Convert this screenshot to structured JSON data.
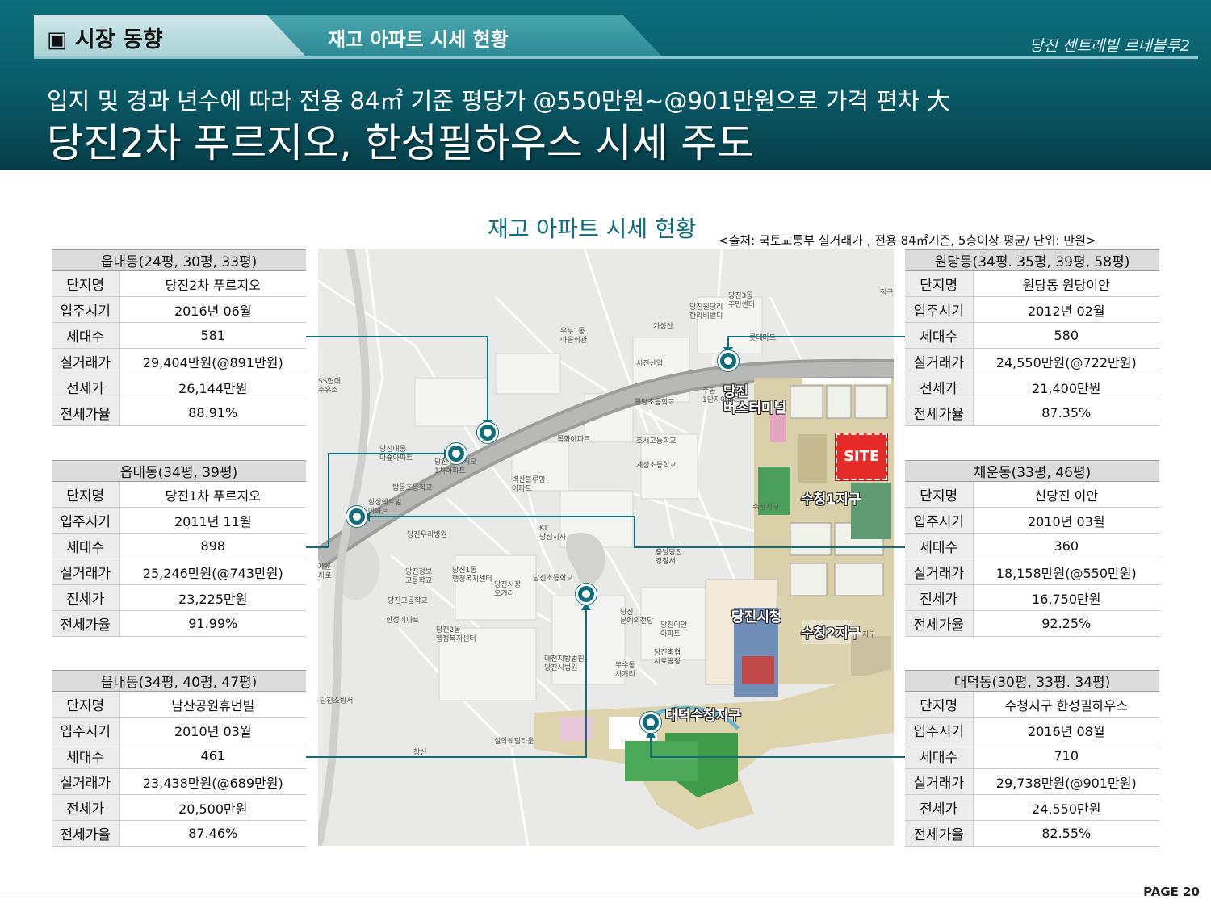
{
  "header": {
    "section_label": "▣ 시장 동향",
    "tab_label": "재고 아파트 시세 현황",
    "brand": "당진 센트레빌 르네블루2",
    "subtitle": "입지 및 경과 년수에 따라 전용 84㎡ 기준 평당가 @550만원~@901만원으로 가격 편차 大",
    "title": "당진2차 푸르지오, 한성필하우스 시세 주도"
  },
  "map_title": "재고 아파트 시세 현황",
  "source_note": "<출처: 국토교통부 실거래가 , 전용 84㎡기준, 5층이상 평균/ 단위: 만원>",
  "row_keys": [
    "단지명",
    "입주시기",
    "세대수",
    "실거래가",
    "전세가",
    "전세가율"
  ],
  "tables": [
    {
      "header": "읍내동(24평, 30평, 33평)",
      "values": [
        "당진2차 푸르지오",
        "2016년 06월",
        "581",
        "29,404만원(@891만원)",
        "26,144만원",
        "88.91%"
      ]
    },
    {
      "header": "읍내동(34평, 39평)",
      "values": [
        "당진1차 푸르지오",
        "2011년 11월",
        "898",
        "25,246만원(@743만원)",
        "23,225만원",
        "91.99%"
      ]
    },
    {
      "header": "읍내동(34평, 40평, 47평)",
      "values": [
        "남산공원휴먼빌",
        "2010년 03월",
        "461",
        "23,438만원(@689만원)",
        "20,500만원",
        "87.46%"
      ]
    },
    {
      "header": "원당동(34평. 35평, 39평, 58평)",
      "values": [
        "원당동 원당이안",
        "2012년 02월",
        "580",
        "24,550만원(@722만원)",
        "21,400만원",
        "87.35%"
      ]
    },
    {
      "header": "채운동(33평, 46평)",
      "values": [
        "신당진 이안",
        "2010년 03월",
        "360",
        "18,158만원(@550만원)",
        "16,750만원",
        "92.25%"
      ]
    },
    {
      "header": "대덕동(30평, 33평. 34평)",
      "values": [
        "수청지구 한성필하우스",
        "2016년 08월",
        "710",
        "29,738만원(@901만원)",
        "24,550만원",
        "82.55%"
      ]
    }
  ],
  "map": {
    "site_label": "SITE",
    "zones": {
      "terminal": "당진\n버스터미널",
      "sucheong1": "수청1지구",
      "sucheong2": "수청2지구",
      "cityhall": "당진시청",
      "daedeok": "대덕수청지구"
    },
    "labels": {
      "l1": "청구",
      "l2": "당진3동\n주민센터",
      "l3": "당진원당리\n한라비발디",
      "l4": "가성산",
      "l5": "롯데마트",
      "l6": "우두1동\n마을회관",
      "l7": "서진산업",
      "l8": "주공\n1단지아파트",
      "l9": "원당초등학교",
      "l10": "목화아파트",
      "l11": "호서고등학교",
      "l12": "계성초등학교",
      "l13": "당진대동\n다숲아파트",
      "l14": "당진 푸르지오\n1차아파트",
      "l15": "벽산블루밍\n아파트",
      "l16": "탑동초등학교",
      "l17": "삼성쉐르빌\n아파트",
      "l18": "KT\n당진지사",
      "l19": "당진우리병원",
      "l20": "충남당진\n경찰서",
      "l21": "당진정보\n고등학교",
      "l22": "당진1동\n행정복지센터",
      "l23": "당진시장\n오거리",
      "l24": "당진초등학교",
      "l25": "당진고등학교",
      "l26": "한성이파트",
      "l27": "당진2동\n행정복지센터",
      "l28": "당진\n문예의전당",
      "l29": "당진이안\n아파트",
      "l30": "대전지방법원\n당진시법원",
      "l31": "무수동\n사거리",
      "l32": "당진축협\n사료공장",
      "l33": "당진소방서",
      "l34": "설악웨딩타운",
      "l35": "창신",
      "l36": "SS현대\n주유소",
      "l37": "수청지구",
      "l38": "지구",
      "l39": "제운\n차로"
    }
  },
  "page": "PAGE 20"
}
